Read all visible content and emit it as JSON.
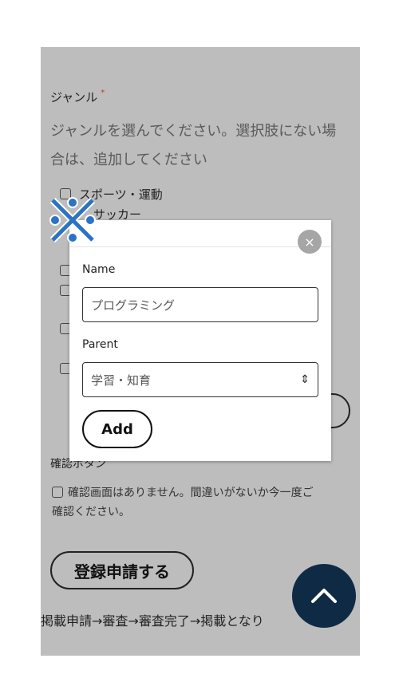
{
  "form": {
    "genre_label": "ジャンル",
    "required_mark": "*",
    "genre_help_line1": "ジャンルを選んでください。選択肢にない場",
    "genre_help_line2": "合は、追加してください",
    "options": [
      "スポーツ・運動",
      "サッカー"
    ],
    "confirm_label": "確認ボタン",
    "confirm_text_line1": "確認画面はありません。間違いがないか今一度ご",
    "confirm_text_line2": "確認ください。",
    "submit_label": "登録申請する",
    "flow_text": "掲載申請→審査→審査完了→掲載となり"
  },
  "modal": {
    "close_symbol": "×",
    "name_label": "Name",
    "name_value": "プログラミング",
    "parent_label": "Parent",
    "parent_value": "学習・知育",
    "select_arrows": "⇕",
    "add_label": "Add"
  },
  "colors": {
    "overlay_gray": "#bdbdbd",
    "scroll_button": "#0f2a45",
    "logo_blue": "#2b73c4"
  },
  "icons": {
    "scroll_top": "chevron-up-icon",
    "logo": "cross-logo-icon"
  }
}
